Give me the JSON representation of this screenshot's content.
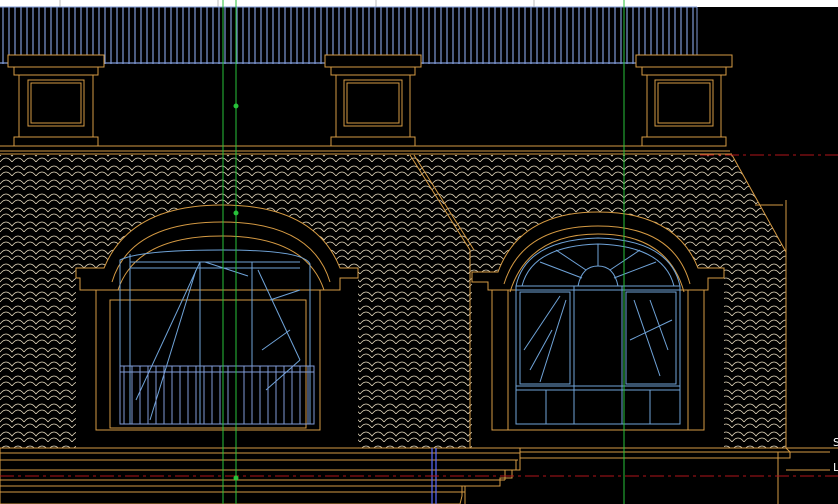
{
  "view": {
    "background": "#000000",
    "mode": "model-space"
  },
  "colors": {
    "architecture": "#d59a43",
    "tile_pattern": "#e8dcc0",
    "railing": "#7f9ad6",
    "window_glazing": "#6fa3d8",
    "guide_line": "#27c23a",
    "center_line": "#b0151a",
    "edge_text": "#ffffff",
    "top_strip": "#ffffff"
  },
  "layers": {
    "parapet": "parapet-railing",
    "chimneys": "chimney-blocks",
    "roof": "mansard-roof-tiles",
    "dormers": "arched-dormers",
    "cornice": "cornice-base",
    "guides": "construction-guides"
  },
  "edge_glyphs": [
    "S",
    "L"
  ]
}
